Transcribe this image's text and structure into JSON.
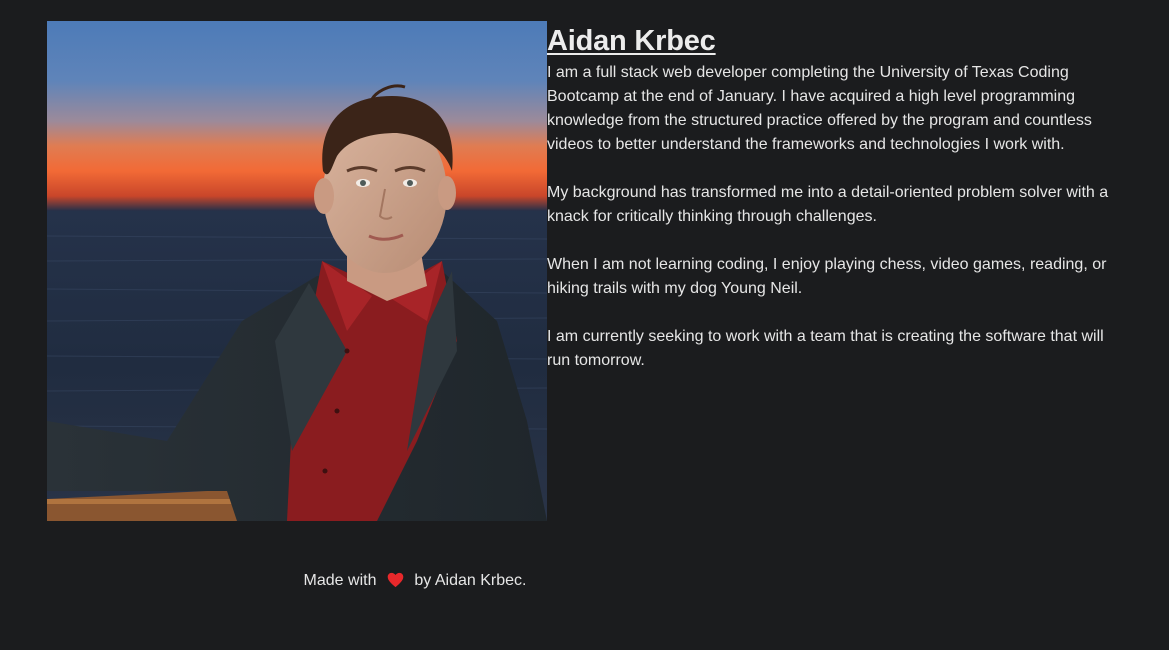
{
  "profile": {
    "name": "Aidan Krbec",
    "bio": [
      "I am a full stack web developer completing the University of Texas Coding Bootcamp at the end of January. I have acquired a high level programming knowledge from the structured practice offered by the program and countless videos to better understand the frameworks and technologies I work with.",
      "My background has transformed me into a detail-oriented problem solver with a knack for critically thinking through challenges.",
      "When I am not learning coding, I enjoy playing chess, video games, reading, or hiking trails with my dog Young Neil.",
      "I am currently seeking to work with a team that is creating the software that will run tomorrow."
    ]
  },
  "footer": {
    "prefix": "Made with",
    "suffix": "by Aidan Krbec.",
    "heart_icon": "heart-icon",
    "heart_color": "#e8282b"
  },
  "colors": {
    "background": "#1b1c1e",
    "text": "#e6e6e6"
  }
}
